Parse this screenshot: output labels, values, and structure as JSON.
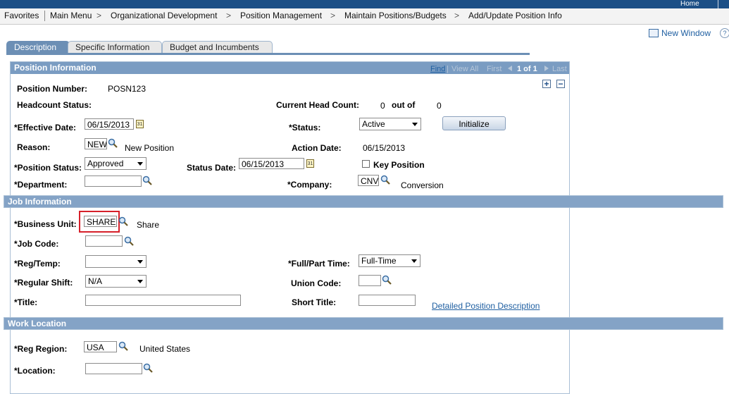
{
  "top": {
    "home": "Home"
  },
  "breadcrumb": [
    "Favorites",
    "Main Menu",
    "Organizational Development",
    "Position Management",
    "Maintain Positions/Budgets",
    "Add/Update Position Info"
  ],
  "sep": ">",
  "new_window": "New Window",
  "help_glyph": "?",
  "tabs": [
    "Description",
    "Specific Information",
    "Budget and Incumbents"
  ],
  "position_info": {
    "title": "Position Information",
    "find": "Find",
    "view_all": "View All",
    "first": "First",
    "counter": "1 of 1",
    "last": "Last",
    "add": "+",
    "remove": "−",
    "position_number_label": "Position Number:",
    "position_number": "POSN123",
    "headcount_label": "Headcount Status:",
    "current_head_label": "Current Head Count:",
    "current_head": "0",
    "out_of": "out of",
    "max_head": "0",
    "effective_date_label": "*Effective Date:",
    "effective_date": "06/15/2013",
    "status_label": "*Status:",
    "status": "Active",
    "initialize": "Initialize",
    "reason_label": "Reason:",
    "reason": "NEW",
    "reason_desc": "New Position",
    "action_date_label": "Action Date:",
    "action_date": "06/15/2013",
    "position_status_label": "*Position Status:",
    "position_status": "Approved",
    "status_date_label": "Status Date:",
    "status_date": "06/15/2013",
    "key_position_label": "Key Position",
    "department_label": "*Department:",
    "department": "",
    "company_label": "*Company:",
    "company": "CNV",
    "company_desc": "Conversion"
  },
  "job_info": {
    "title": "Job Information",
    "business_unit_label": "*Business Unit:",
    "business_unit": "SHARE",
    "business_unit_desc": "Share",
    "job_code_label": "*Job Code:",
    "job_code": "",
    "reg_temp_label": "*Reg/Temp:",
    "reg_temp": "",
    "full_part_label": "*Full/Part Time:",
    "full_part": "Full-Time",
    "regular_shift_label": "*Regular Shift:",
    "regular_shift": "N/A",
    "union_code_label": "Union Code:",
    "union_code": "",
    "title_label": "*Title:",
    "title_value": "",
    "short_title_label": "Short Title:",
    "short_title": "",
    "detailed_link": "Detailed Position Description"
  },
  "work_location": {
    "title": "Work Location",
    "reg_region_label": "*Reg Region:",
    "reg_region": "USA",
    "reg_region_desc": "United States",
    "location_label": "*Location:",
    "location": ""
  },
  "colors": {
    "header_blue": "#7a9cc2",
    "link_blue": "#1f5fa1",
    "highlight_red": "#d6202a"
  }
}
